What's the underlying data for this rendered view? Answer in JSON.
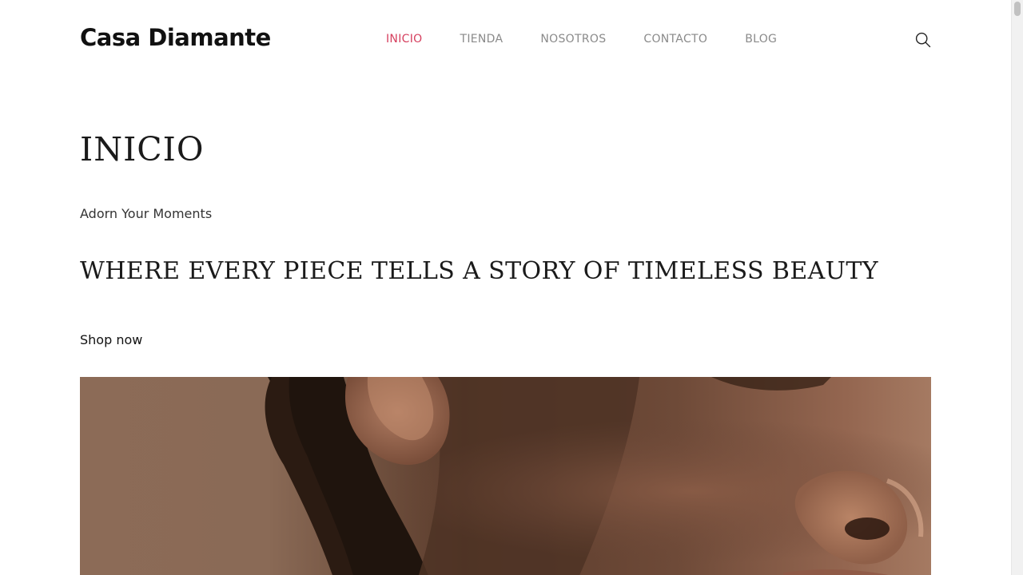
{
  "header": {
    "logo": "Casa Diamante",
    "nav": [
      {
        "label": "INICIO",
        "active": true
      },
      {
        "label": "TIENDA",
        "active": false
      },
      {
        "label": "NOSOTROS",
        "active": false
      },
      {
        "label": "CONTACTO",
        "active": false
      },
      {
        "label": "BLOG",
        "active": false
      }
    ],
    "search_icon": "search-icon"
  },
  "hero": {
    "title": "INICIO",
    "tagline": "Adorn Your Moments",
    "headline": "WHERE EVERY PIECE TELLS A STORY OF TIMELESS BEAUTY",
    "cta": "Shop now",
    "image_subject": "close-up of a face with ear"
  },
  "colors": {
    "accent": "#d6405f",
    "nav_text": "#8a8a8a",
    "text": "#1a1a1a"
  }
}
